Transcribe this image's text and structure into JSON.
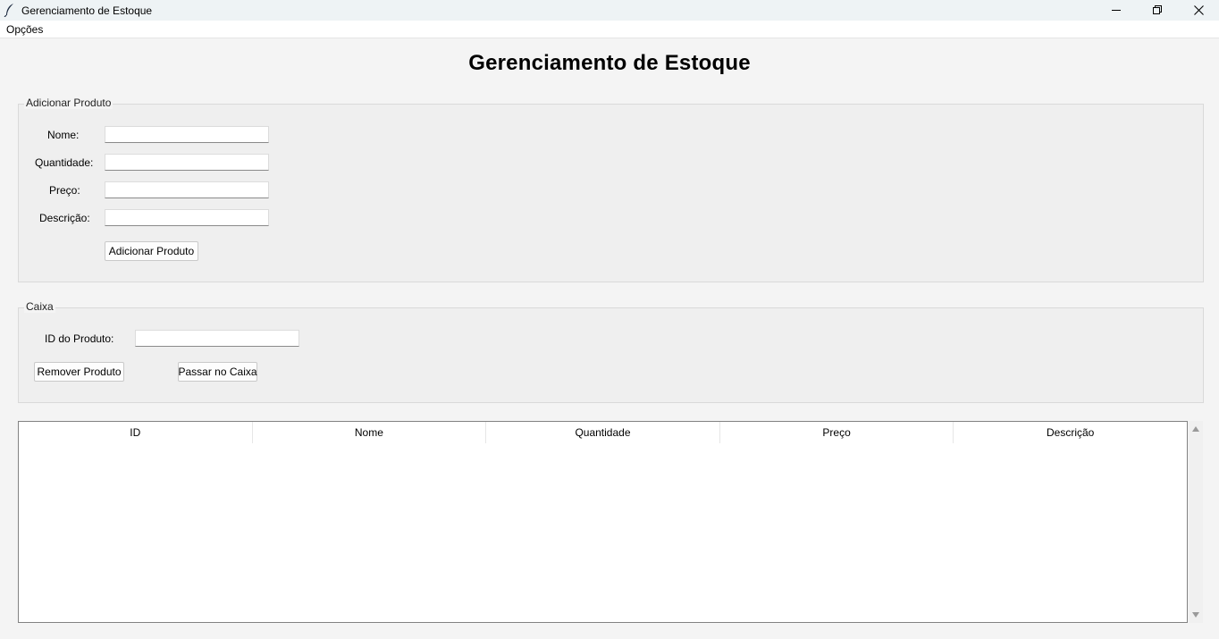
{
  "window": {
    "title": "Gerenciamento de Estoque",
    "icons": [
      "feather-icon",
      "minimize-icon",
      "restore-icon",
      "close-icon"
    ]
  },
  "menu": {
    "items": [
      "Opções"
    ]
  },
  "header": {
    "title": "Gerenciamento de Estoque"
  },
  "add_product": {
    "legend": "Adicionar Produto",
    "fields": [
      {
        "label": "Nome:",
        "value": ""
      },
      {
        "label": "Quantidade:",
        "value": ""
      },
      {
        "label": "Preço:",
        "value": ""
      },
      {
        "label": "Descrição:",
        "value": ""
      }
    ],
    "button_label": "Adicionar Produto"
  },
  "cashier": {
    "legend": "Caixa",
    "id_label": "ID do Produto:",
    "id_value": "",
    "remove_label": "Remover Produto",
    "checkout_label": "Passar no Caixa"
  },
  "table": {
    "columns": [
      "ID",
      "Nome",
      "Quantidade",
      "Preço",
      "Descrição"
    ],
    "rows": []
  },
  "colors": {
    "titlebar_bg": "#eef3f5",
    "window_bg": "#f4f4f4",
    "group_bg": "#efefef"
  }
}
